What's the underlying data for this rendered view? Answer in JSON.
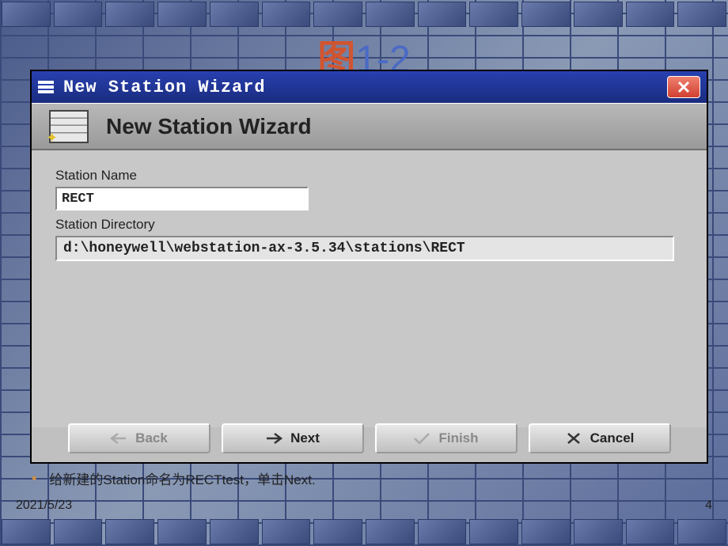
{
  "slide": {
    "title_cn": "图",
    "title_num": "1-2",
    "caption": "给新建的Station命名为RECTtest，单击Next.",
    "date": "2021/5/23",
    "page_num": "4"
  },
  "window": {
    "title": "New Station Wizard",
    "header": "New Station Wizard"
  },
  "form": {
    "name_label": "Station Name",
    "name_value": "RECT",
    "dir_label": "Station Directory",
    "dir_value": "d:\\honeywell\\webstation-ax-3.5.34\\stations\\RECT"
  },
  "buttons": {
    "back": "Back",
    "next": "Next",
    "finish": "Finish",
    "cancel": "Cancel"
  }
}
